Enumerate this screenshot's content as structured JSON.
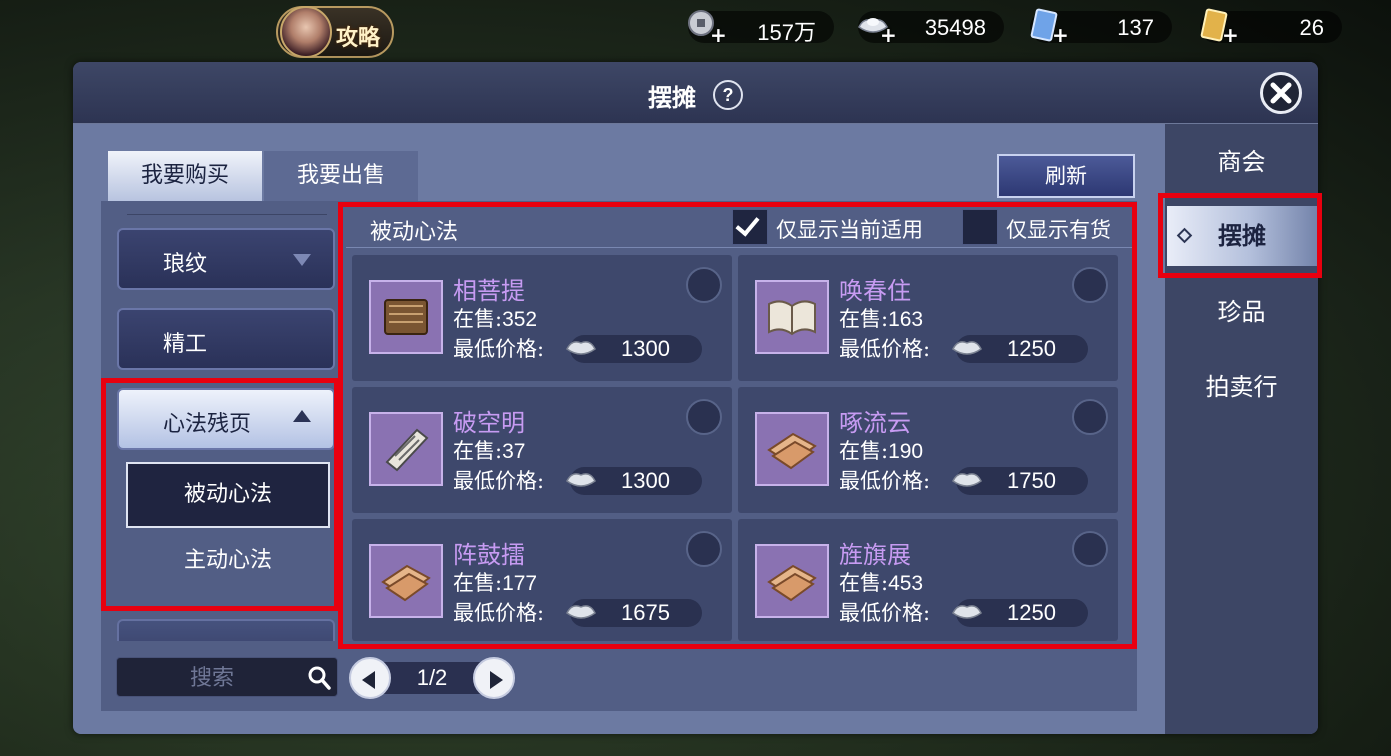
{
  "topbar": {
    "guide_label": "攻略",
    "currencies": [
      {
        "icon": "copper-coin-icon",
        "value": "157万"
      },
      {
        "icon": "silver-ingot-icon",
        "value": "35498"
      },
      {
        "icon": "blue-ticket-icon",
        "value": "137"
      },
      {
        "icon": "gold-ticket-icon",
        "value": "26"
      }
    ],
    "plus": "+"
  },
  "panel": {
    "title": "摆摊",
    "help": "?"
  },
  "tabs": {
    "buy": "我要购买",
    "sell": "我要出售"
  },
  "refresh_label": "刷新",
  "nav": {
    "items": [
      "商会",
      "摆摊",
      "珍品",
      "拍卖行"
    ],
    "active": "摆摊"
  },
  "categories": {
    "items": [
      {
        "label": "琅纹",
        "expanded": false
      },
      {
        "label": "精工"
      },
      {
        "label": "心法残页",
        "expanded": true
      }
    ],
    "sub_items": [
      "被动心法",
      "主动心法"
    ],
    "selected_sub": "被动心法"
  },
  "search": {
    "placeholder": "搜索"
  },
  "pager": {
    "label": "1/2"
  },
  "list": {
    "title": "被动心法",
    "filter_applicable": {
      "label": "仅显示当前适用",
      "checked": true
    },
    "filter_in_stock": {
      "label": "仅显示有货",
      "checked": false
    },
    "stock_prefix": "在售:",
    "price_prefix": "最低价格:",
    "items": [
      {
        "name": "相菩提",
        "stock": "352",
        "price": "1300",
        "icon": "scroll-bundle-icon"
      },
      {
        "name": "唤春住",
        "stock": "163",
        "price": "1250",
        "icon": "open-book-icon"
      },
      {
        "name": "破空明",
        "stock": "37",
        "price": "1300",
        "icon": "paper-scroll-icon"
      },
      {
        "name": "啄流云",
        "stock": "190",
        "price": "1750",
        "icon": "torn-pages-icon"
      },
      {
        "name": "阵鼓擂",
        "stock": "177",
        "price": "1675",
        "icon": "torn-pages-icon"
      },
      {
        "name": "旌旗展",
        "stock": "453",
        "price": "1250",
        "icon": "torn-pages-icon"
      }
    ]
  },
  "colors": {
    "highlight_red": "#e8000f",
    "item_name": "#c79bf2",
    "panel": "#4a5578"
  }
}
